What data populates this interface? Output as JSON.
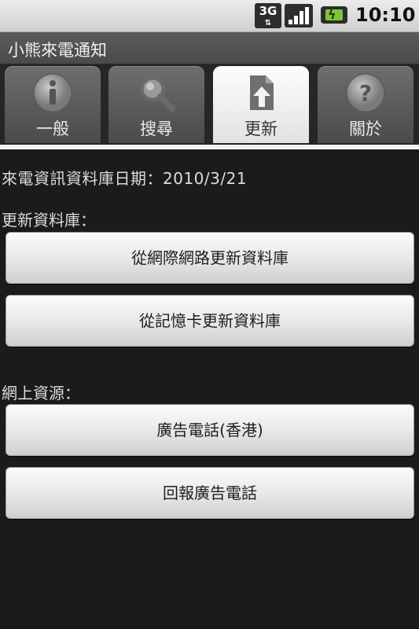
{
  "status_bar": {
    "network": "3G",
    "time": "10:10",
    "icons": [
      "3g-icon",
      "signal-icon",
      "battery-charging-icon"
    ]
  },
  "app": {
    "title": "小熊來電通知"
  },
  "tabs": [
    {
      "label": "一般",
      "icon": "info-icon",
      "active": false
    },
    {
      "label": "搜尋",
      "icon": "magnifier-icon",
      "active": false
    },
    {
      "label": "更新",
      "icon": "update-file-icon",
      "active": true
    },
    {
      "label": "關於",
      "icon": "help-icon",
      "active": false
    }
  ],
  "content": {
    "db_date": "來電資訊資料庫日期：2010/3/21",
    "update_section_label": "更新資料庫：",
    "update_buttons": [
      "從網際網路更新資料庫",
      "從記憶卡更新資料庫"
    ],
    "online_section_label": "網上資源：",
    "online_buttons": [
      "廣告電話(香港)",
      "回報廣告電話"
    ]
  },
  "colors": {
    "background": "#1b1b1b",
    "status_bar": "#e0e0e0",
    "title_bar": "#545454",
    "active_tab": "#f5f5f5",
    "inactive_tab": "#5a5a5a"
  }
}
